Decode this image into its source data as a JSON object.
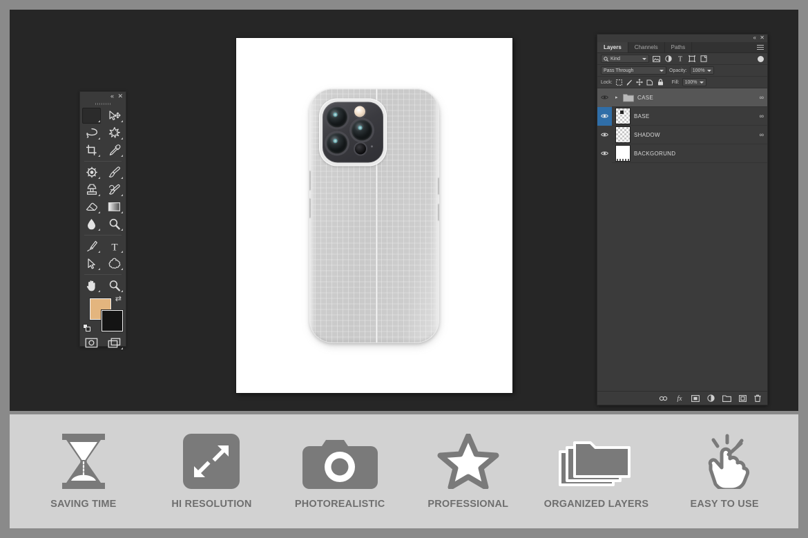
{
  "app": {
    "canvas_bg": "#262626",
    "frame_bg": "#8a8a8a",
    "panel_bg": "#3b3b3b"
  },
  "toolbar": {
    "collapse_icon": "«",
    "close_icon": "✕",
    "tools": [
      {
        "id": "rectangular-marquee",
        "label": "Rectangular Marquee Tool",
        "selected": true
      },
      {
        "id": "move",
        "label": "Move Tool",
        "selected": false
      },
      {
        "id": "lasso",
        "label": "Lasso Tool",
        "selected": false
      },
      {
        "id": "magic-wand",
        "label": "Magic Wand Tool",
        "selected": false
      },
      {
        "id": "crop",
        "label": "Crop Tool",
        "selected": false
      },
      {
        "id": "eyedropper",
        "label": "Eyedropper Tool",
        "selected": false
      },
      {
        "id": "spot-healing-brush",
        "label": "Spot Healing Brush Tool",
        "selected": false
      },
      {
        "id": "brush",
        "label": "Brush Tool",
        "selected": false
      },
      {
        "id": "clone-stamp",
        "label": "Clone Stamp Tool",
        "selected": false
      },
      {
        "id": "history-brush",
        "label": "History Brush Tool",
        "selected": false
      },
      {
        "id": "eraser",
        "label": "Eraser Tool",
        "selected": false
      },
      {
        "id": "gradient",
        "label": "Gradient Tool",
        "selected": false
      },
      {
        "id": "blur",
        "label": "Blur Tool",
        "selected": false
      },
      {
        "id": "dodge",
        "label": "Dodge Tool",
        "selected": false
      },
      {
        "id": "pen",
        "label": "Pen Tool",
        "selected": false
      },
      {
        "id": "type",
        "label": "Horizontal Type Tool",
        "selected": false
      },
      {
        "id": "path-selection",
        "label": "Path Selection Tool",
        "selected": false
      },
      {
        "id": "custom-shape",
        "label": "Custom Shape Tool",
        "selected": false
      },
      {
        "id": "hand",
        "label": "Hand Tool",
        "selected": false
      },
      {
        "id": "zoom",
        "label": "Zoom Tool",
        "selected": false
      }
    ],
    "colors": {
      "foreground": "#e3b57e",
      "background": "#141414",
      "swap_icon": "⇄"
    },
    "footer_tools": [
      {
        "id": "quick-mask",
        "label": "Edit in Quick Mask Mode"
      },
      {
        "id": "screen-mode",
        "label": "Change Screen Mode"
      }
    ]
  },
  "layers_panel": {
    "collapse_icon": "«",
    "close_icon": "✕",
    "tabs": [
      {
        "label": "Layers",
        "active": true
      },
      {
        "label": "Channels",
        "active": false
      },
      {
        "label": "Paths",
        "active": false
      }
    ],
    "filter": {
      "kind_label": "Kind",
      "search_icon": "search-icon",
      "filter_icons": [
        "pixel-filter-icon",
        "adjustment-filter-icon",
        "type-filter-icon",
        "shape-filter-icon",
        "smart-object-filter-icon"
      ],
      "toggle_on": true
    },
    "blend": {
      "mode": "Pass Through",
      "opacity_label": "Opacity:",
      "opacity_value": "100%"
    },
    "lock": {
      "label": "Lock:",
      "icons": [
        "lock-transparent-icon",
        "lock-image-icon",
        "lock-position-icon",
        "lock-artboard-icon",
        "lock-all-icon"
      ],
      "fill_label": "Fill:",
      "fill_value": "100%"
    },
    "layers": [
      {
        "name": "CASE",
        "type": "group",
        "visible": true,
        "selected": true,
        "highlight": "amber",
        "linked": true,
        "expanded": false,
        "thumb": "folder"
      },
      {
        "name": "BASE",
        "type": "layer",
        "visible": true,
        "selected": false,
        "highlight": "blue",
        "linked": true,
        "thumb": "checker-blob"
      },
      {
        "name": "SHADOW",
        "type": "layer",
        "visible": true,
        "selected": false,
        "highlight": "none",
        "linked": true,
        "thumb": "checker"
      },
      {
        "name": "BACKGORUND",
        "type": "layer",
        "visible": true,
        "selected": false,
        "highlight": "none",
        "linked": false,
        "thumb": "white"
      }
    ],
    "bottom_buttons": [
      {
        "id": "link-layers",
        "label": "Link layers",
        "glyph": "link-icon"
      },
      {
        "id": "layer-style",
        "label": "Add a layer style",
        "glyph": "fx-icon"
      },
      {
        "id": "layer-mask",
        "label": "Add layer mask",
        "glyph": "mask-icon"
      },
      {
        "id": "adjustment-layer",
        "label": "Create new fill or adjustment layer",
        "glyph": "adjustment-icon"
      },
      {
        "id": "new-group",
        "label": "Create a new group",
        "glyph": "folder-icon"
      },
      {
        "id": "new-layer",
        "label": "Create a new layer",
        "glyph": "new-layer-icon"
      },
      {
        "id": "delete-layer",
        "label": "Delete layer",
        "glyph": "trash-icon"
      }
    ]
  },
  "document": {
    "subject": "iPhone Pro phone case mockup, back view",
    "background": "#ffffff"
  },
  "features": [
    {
      "label": "SAVING TIME",
      "icon": "hourglass-icon"
    },
    {
      "label": "HI RESOLUTION",
      "icon": "resize-arrows-icon"
    },
    {
      "label": "PHOTOREALISTIC",
      "icon": "camera-icon"
    },
    {
      "label": "PROFESSIONAL",
      "icon": "star-icon"
    },
    {
      "label": "ORGANIZED LAYERS",
      "icon": "layers-folders-icon"
    },
    {
      "label": "EASY TO USE",
      "icon": "click-hand-icon"
    }
  ]
}
